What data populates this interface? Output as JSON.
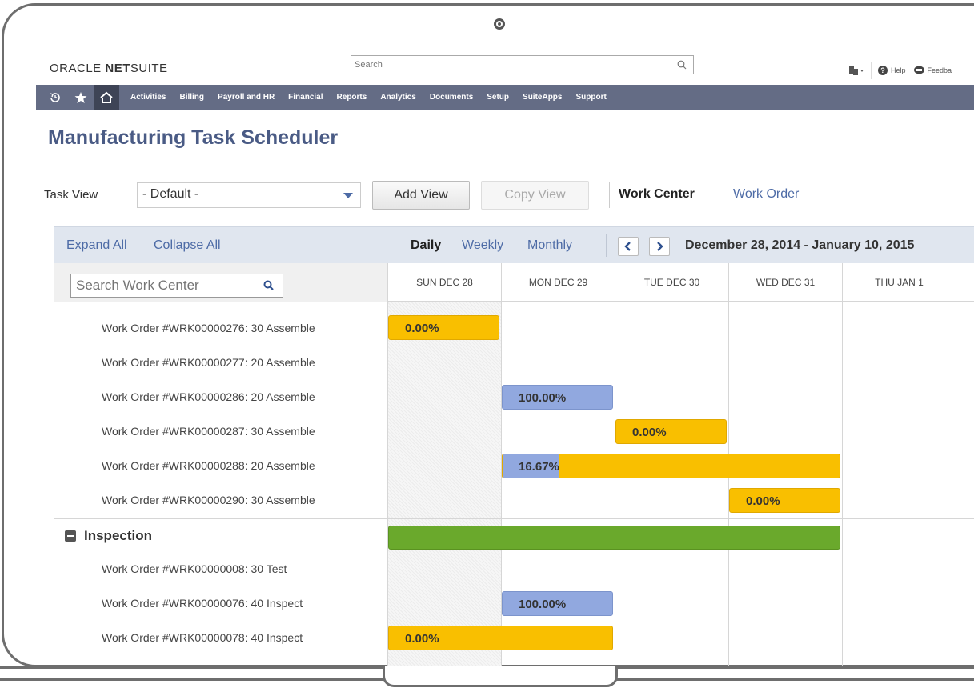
{
  "app": {
    "logo_brand": "ORACLE",
    "logo_product_bold": "NET",
    "logo_product": "SUITE",
    "search_placeholder": "Search",
    "help_label": "Help",
    "feedback_label": "Feedba"
  },
  "nav": {
    "items": [
      "Activities",
      "Billing",
      "Payroll and HR",
      "Financial",
      "Reports",
      "Analytics",
      "Documents",
      "Setup",
      "SuiteApps",
      "Support"
    ]
  },
  "page": {
    "title": "Manufacturing Task Scheduler"
  },
  "toolbar": {
    "task_view_label": "Task View",
    "task_view_value": "- Default -",
    "add_view": "Add View",
    "copy_view": "Copy View",
    "work_center": "Work Center",
    "work_order": "Work Order"
  },
  "scheduler": {
    "expand_all": "Expand All",
    "collapse_all": "Collapse All",
    "daily": "Daily",
    "weekly": "Weekly",
    "monthly": "Monthly",
    "date_range": "December 28, 2014 - January 10, 2015",
    "search_placeholder": "Search Work Center",
    "days": [
      "SUN DEC 28",
      "MON DEC 29",
      "TUE DEC 30",
      "WED DEC 31",
      "THU JAN 1"
    ],
    "rows": [
      {
        "label": "Work Order #WRK00000276: 30 Assemble",
        "bar": "0.00%"
      },
      {
        "label": "Work Order #WRK00000277: 20 Assemble",
        "bar": ""
      },
      {
        "label": "Work Order #WRK00000286: 20 Assemble",
        "bar": "100.00%"
      },
      {
        "label": "Work Order #WRK00000287: 30 Assemble",
        "bar": "0.00%"
      },
      {
        "label": "Work Order #WRK00000288: 20 Assemble",
        "bar": "16.67%",
        "progress": 0.1667
      },
      {
        "label": "Work Order #WRK00000290: 30 Assemble",
        "bar": "0.00%"
      }
    ],
    "group_name": "Inspection",
    "group_rows": [
      {
        "label": "Work Order #WRK00000008: 30 Test",
        "bar": ""
      },
      {
        "label": "Work Order #WRK00000076: 40 Inspect",
        "bar": "100.00%"
      },
      {
        "label": "Work Order #WRK00000078: 40 Inspect",
        "bar": "0.00%"
      }
    ]
  },
  "colors": {
    "nav_bg": "#646c85",
    "title": "#4a5b85",
    "link": "#4d6ba6",
    "bar_pending": "#f9bf00",
    "bar_complete": "#91a8df",
    "bar_group": "#6aa92c"
  }
}
